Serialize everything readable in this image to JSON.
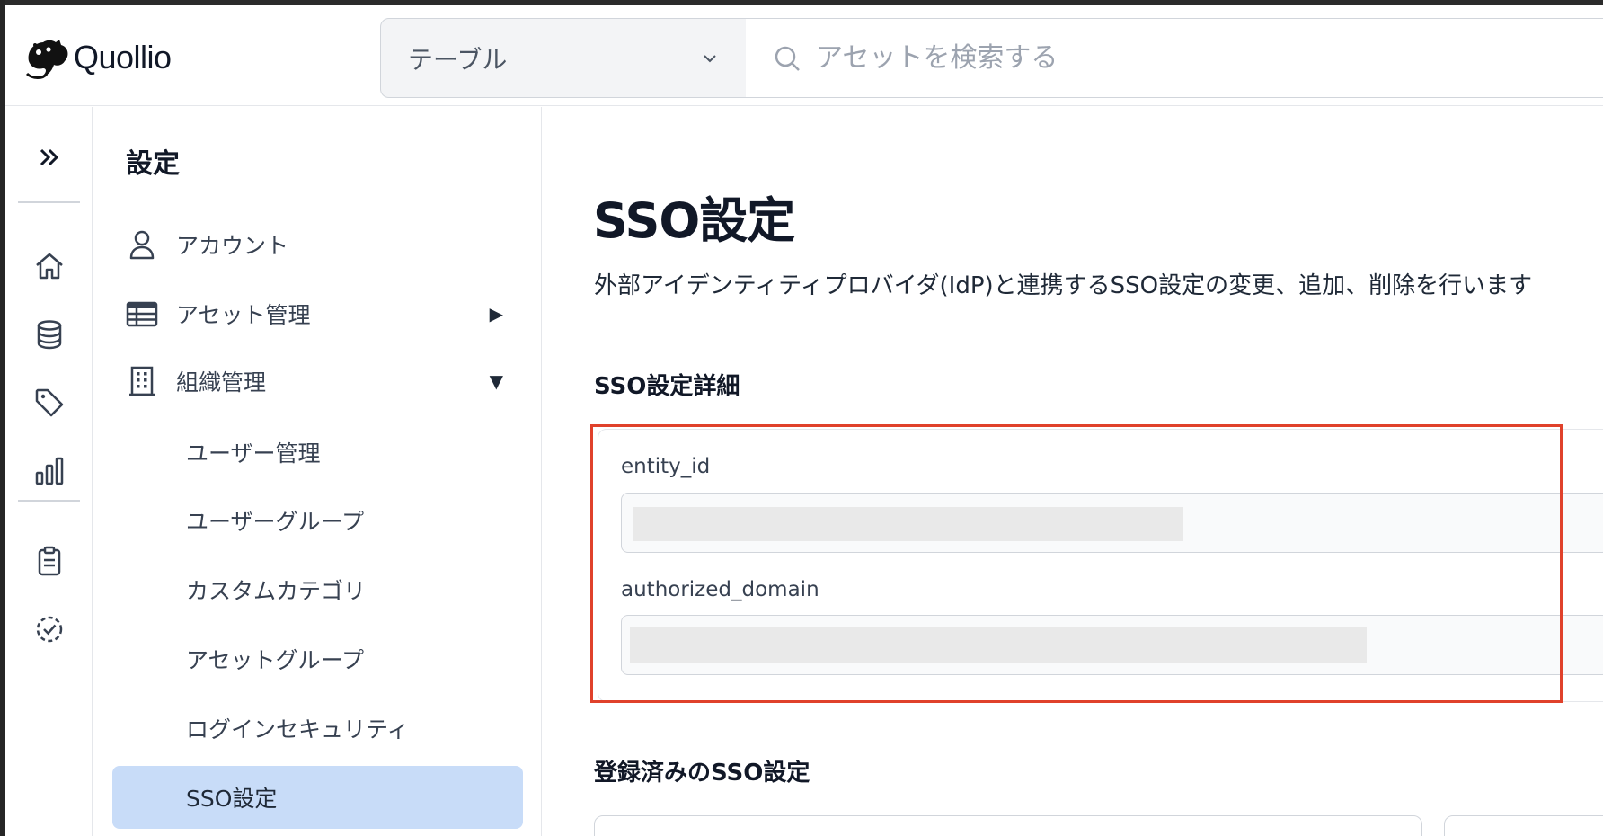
{
  "brand": {
    "name": "Quollio"
  },
  "header": {
    "type_select": {
      "label": "テーブル",
      "icon": "chevron-down-icon"
    },
    "search": {
      "placeholder": "アセットを検索する",
      "icon": "search-icon"
    }
  },
  "rail": {
    "items": [
      "expand-icon",
      "home-icon",
      "database-icon",
      "tag-icon",
      "bar-chart-icon",
      "clipboard-icon",
      "check-circle-icon"
    ]
  },
  "sidebar": {
    "title": "設定",
    "items": [
      {
        "label": "アカウント",
        "icon": "user-icon"
      },
      {
        "label": "アセット管理",
        "icon": "table-icon",
        "arrow": "▶"
      },
      {
        "label": "組織管理",
        "icon": "building-icon",
        "arrow": "▼"
      }
    ],
    "subitems": [
      "ユーザー管理",
      "ユーザーグループ",
      "カスタムカテゴリ",
      "アセットグループ",
      "ログインセキュリティ",
      "SSO設定"
    ],
    "active_subitem": "SSO設定"
  },
  "main": {
    "title": "SSO設定",
    "description": "外部アイデンティティプロバイダ(IdP)と連携するSSO設定の変更、追加、削除を行います",
    "details_heading": "SSO設定詳細",
    "fields": [
      {
        "label": "entity_id",
        "value": ""
      },
      {
        "label": "authorized_domain",
        "value": ""
      }
    ],
    "registered_heading": "登録済みのSSO設定"
  },
  "colors": {
    "highlight": "#e0412b",
    "active_nav": "#c8dcf8"
  }
}
